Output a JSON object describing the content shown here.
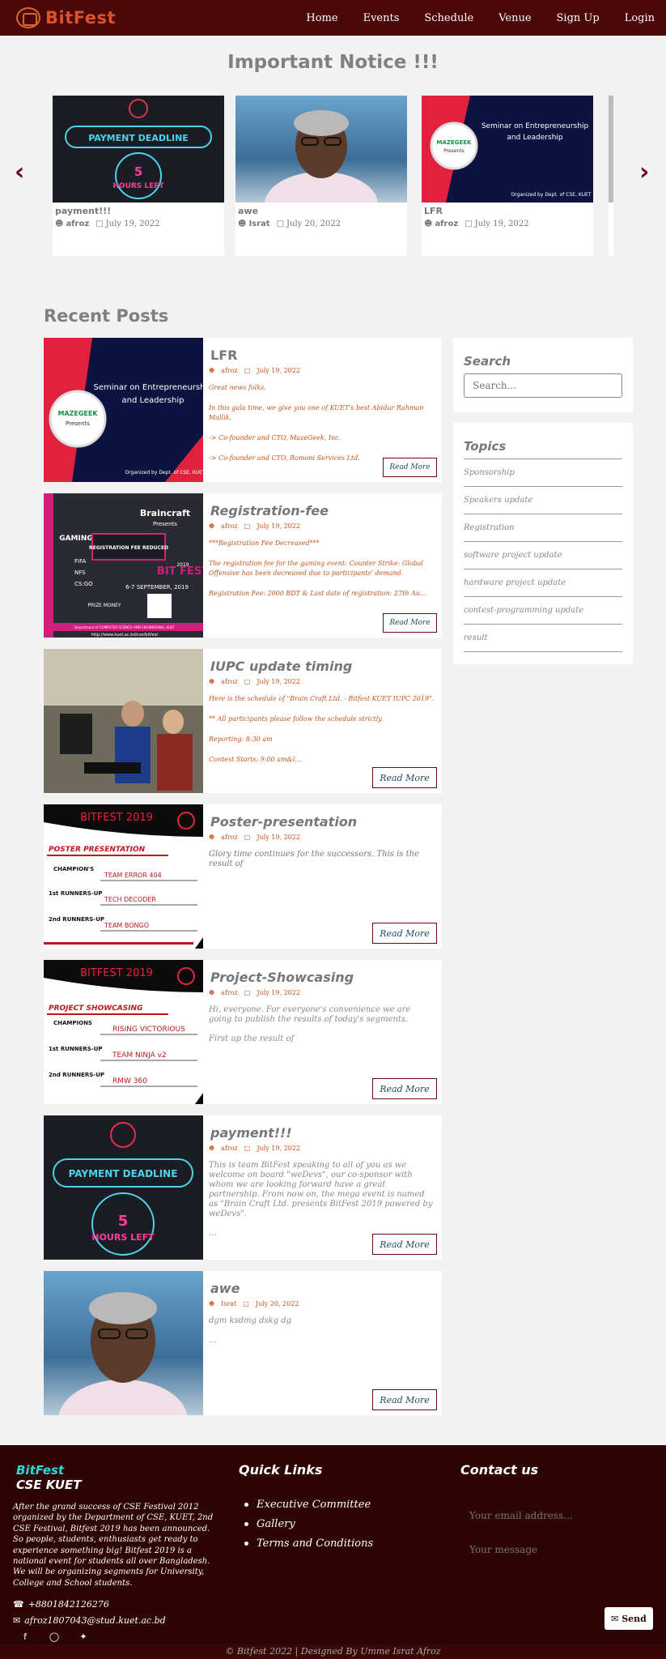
{
  "navbar": {
    "brand": "BitFest",
    "links": [
      "Home",
      "Events",
      "Schedule",
      "Venue",
      "Sign Up",
      "Login"
    ]
  },
  "notice": {
    "title": "Important Notice !!!",
    "cards": [
      {
        "title": "payment!!!",
        "author": "afroz",
        "date": "July 19, 2022",
        "image_text_1": "PAYMENT DEADLINE",
        "image_text_2": "5",
        "image_text_3": "HOURS LEFT"
      },
      {
        "title": "awe",
        "author": "Israt",
        "date": "July 20, 2022"
      },
      {
        "title": "LFR",
        "author": "afroz",
        "date": "July 19, 2022",
        "image_text_1": "Seminar on Entrepreneurship and Leadership",
        "image_text_2": "MAZEGEEK Presents",
        "image_text_3": "Organized by Dept. of CSE, KUET"
      }
    ]
  },
  "recent": {
    "title": "Recent Posts",
    "read_more": "Read More",
    "posts": [
      {
        "title": "LFR",
        "author": "afroz",
        "date": "July 19, 2022",
        "lines": [
          "Great news folks.",
          "In this gala time, we give you one of KUET's best Abidur Rahman Mallik,",
          "-> Co-founder and CTO, MazeGeek, Inc.",
          "-> Co-founder and CTO, Romoni Services Ltd."
        ]
      },
      {
        "title": "Registration-fee",
        "author": "afroz",
        "date": "July 19, 2022",
        "lines": [
          "***Registration Fee Decreased***",
          "The registration fee for the gaming event: Counter Strike: Global Offensive has been decreased due to participants' demand.",
          "Registration Fee: 2000 BDT & Last date of registration: 27th Au…"
        ]
      },
      {
        "title": "IUPC update timing",
        "author": "afroz",
        "date": "July 19, 2022",
        "lines": [
          "Here is the schedule of \"Brain Craft Ltd. - Bitfest KUET IUPC 2019\".",
          "** All participants please follow the schedule strictly.",
          "Reporting: 8:30 am",
          "Contest Starts: 9:00 am&l…"
        ]
      },
      {
        "title": "Poster-presentation",
        "author": "afroz",
        "date": "July 19, 2022",
        "lines": [
          "Glory time continues for the successors. This is the result of"
        ]
      },
      {
        "title": "Project-Showcasing",
        "author": "afroz",
        "date": "July 19, 2022",
        "lines": [
          "Hi, everyone. For everyone's convenience we are going to publish the results of today's segments.",
          "First up the result of"
        ]
      },
      {
        "title": "payment!!!",
        "author": "afroz",
        "date": "July 19, 2022",
        "lines": [
          "This is team BitFest speaking to all of you as we welcome on board \"weDevs\", our co-sponsor with whom we are looking forward have a great partnership. From now on, the mega event is named as \"Brain Craft Ltd. presents BitFest 2019 powered by weDevs\".",
          "…"
        ]
      },
      {
        "title": "awe",
        "author": "Israt",
        "date": "July 20, 2022",
        "lines": [
          "dgm ksdmg dskg dg",
          "…"
        ]
      }
    ],
    "poster": {
      "header": "BITFEST 2019",
      "poster_title": "POSTER PRESENTATION",
      "champion_label": "CHAMPION'S",
      "team_name_label": "TEAM NAME",
      "runner1_label": "1st RUNNERS-UP",
      "runner2_label": "2nd RUNNERS-UP",
      "team1": "TEAM ERROR 404",
      "team2": "TECH DECODER",
      "team3": "TEAM BONGO"
    },
    "project": {
      "header": "BITFEST 2019",
      "poster_title": "PROJECT SHOWCASING",
      "champion_label": "CHAMPIONS",
      "team_name_label": "TEAM NAME",
      "runner1_label": "1st RUNNERS-UP",
      "runner2_label": "2nd RUNNERS-UP",
      "team1": "RISING VICTORIOUS",
      "team2": "TEAM NINJA v2",
      "team3": "RMW 360"
    },
    "brain": {
      "sponsor": "Braincraft",
      "presents": "Presents",
      "gaming": "GAMING",
      "reg": "REGISTRATION FEE REDUCED",
      "games": [
        "FIFA",
        "NFS",
        "CS:GO"
      ],
      "prize": "PRIZE MONEY",
      "date": "6-7 SEPTEMBER, 2019",
      "bitfest": "BIT FEST",
      "year": "2019",
      "dept": "Department of COMPUTER SCIENCE AND ENGINEERING, KUET",
      "url": "http://www.kuet.ac.bd/cse/bitfest"
    }
  },
  "sidebar": {
    "search_title": "Search",
    "search_placeholder": "Search...",
    "topics_title": "Topics",
    "topics": [
      "Sponsorship",
      "Speakers update",
      "Registration",
      "software project update",
      "hardware project update",
      "contest-programming update",
      "result"
    ]
  },
  "footer": {
    "brand1": "BitFest",
    "brand2": "CSE KUET",
    "about": "After the grand success of CSE Festival 2012 organized by the Department of CSE, KUET, 2nd CSE Festival, Bitfest 2019 has been announced. So people, students, enthusiasts get ready to experience something big! Bitfest 2019 is a national event for students all over Bangladesh. We will be organizing segments for University, College and School students.",
    "phone": "+8801842126276",
    "email": "afroz1807043@stud.kuet.ac.bd",
    "quick_links_title": "Quick Links",
    "quick_links": [
      "Executive Committee",
      "Gallery",
      "Terms and Conditions"
    ],
    "contact_title": "Contact us",
    "email_placeholder": "Your email address...",
    "message_placeholder": "Your message",
    "send_label": "Send",
    "copyright": "© Bitfest 2022 | Designed By Umme Israt Afroz"
  },
  "colors": {
    "nav_bg": "#4a0808",
    "brand": "#d9532b",
    "accent_maroon": "#6b0a1a",
    "footer_bg": "#2e0505",
    "footer_brand": "#2fd6d6",
    "meta_orange": "#c0551a"
  },
  "icons": [
    "user-icon",
    "calendar-icon",
    "phone-icon",
    "envelope-icon",
    "facebook-icon",
    "instagram-icon",
    "twitter-icon",
    "chevron-left-icon",
    "chevron-right-icon"
  ]
}
